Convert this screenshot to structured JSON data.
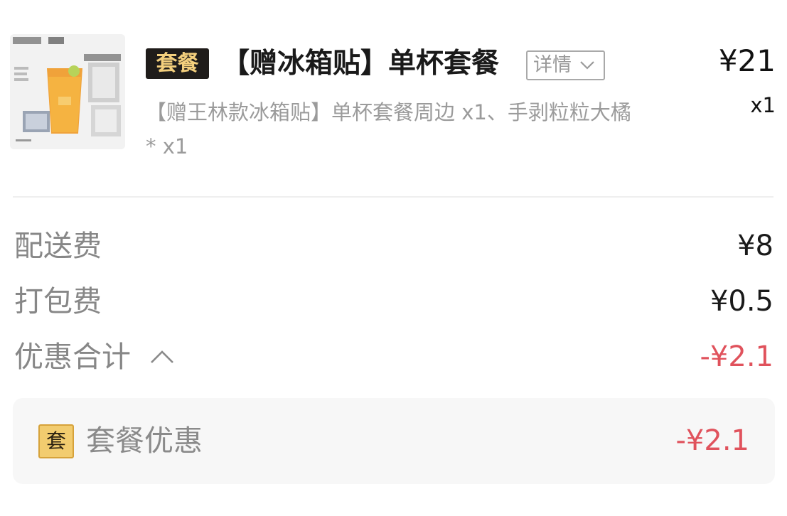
{
  "product": {
    "image_alt": "单杯套餐商品图",
    "tag": "套餐",
    "name": "【赠冰箱贴】单杯套餐",
    "detail_label": "详情",
    "description": "【赠王林款冰箱贴】单杯套餐周边 x1、手剥粒粒大橘* x1",
    "price": "¥21",
    "quantity": "x1"
  },
  "fees": [
    {
      "label": "配送费",
      "value": "¥8"
    },
    {
      "label": "打包费",
      "value": "¥0.5"
    }
  ],
  "discount_total": {
    "label": "优惠合计",
    "value": "-¥2.1",
    "expanded": true
  },
  "discount_items": [
    {
      "badge": "套",
      "label": "套餐优惠",
      "value": "-¥2.1"
    }
  ],
  "colors": {
    "discount_red": "#e0525c",
    "tag_bg": "#1f1c1a",
    "tag_text": "#f3cf7d",
    "badge_bg": "#f2cc6f"
  }
}
